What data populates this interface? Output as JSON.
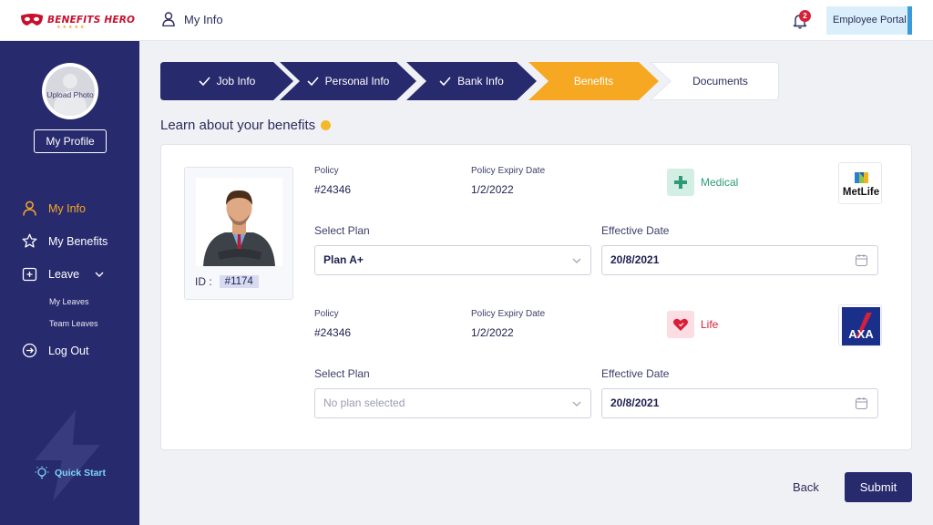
{
  "brand": {
    "name": "BENEFITS HERO"
  },
  "header": {
    "title": "My Info",
    "notifications_count": "2",
    "portal_label": "Employee Portal"
  },
  "sidebar": {
    "avatar_label": "Upload Photo",
    "profile_button": "My Profile",
    "items": [
      {
        "label": "My Info",
        "icon": "user-icon",
        "active": true
      },
      {
        "label": "My Benefits",
        "icon": "star-icon",
        "active": false
      },
      {
        "label": "Leave",
        "icon": "leave-icon",
        "active": false
      },
      {
        "label": "Log Out",
        "icon": "logout-icon",
        "active": false
      }
    ],
    "sub_items": [
      {
        "label": "My Leaves"
      },
      {
        "label": "Team Leaves"
      }
    ],
    "quick_start": "Quick Start"
  },
  "stepper": {
    "steps": [
      {
        "label": "Job Info",
        "state": "done"
      },
      {
        "label": "Personal Info",
        "state": "done"
      },
      {
        "label": "Bank Info",
        "state": "done"
      },
      {
        "label": "Benefits",
        "state": "current"
      },
      {
        "label": "Documents",
        "state": "upcoming"
      }
    ]
  },
  "colors": {
    "navy": "#282a6e",
    "accent": "#f7a823",
    "medical": "#2e9b78",
    "life": "#d6203a"
  },
  "section_title": "Learn about your benefits",
  "employee": {
    "id_label": "ID :",
    "id_value": "#1174"
  },
  "benefits": [
    {
      "policy_label": "Policy",
      "policy": "#24346",
      "expiry_label": "Policy Expiry Date",
      "expiry": "1/2/2022",
      "type": "Medical",
      "provider": "MetLife",
      "select_plan_label": "Select Plan",
      "plan": "Plan A+",
      "effective_label": "Effective Date",
      "effective_date": "20/8/2021"
    },
    {
      "policy_label": "Policy",
      "policy": "#24346",
      "expiry_label": "Policy Expiry Date",
      "expiry": "1/2/2022",
      "type": "Life",
      "provider": "AXA",
      "select_plan_label": "Select Plan",
      "plan_placeholder": "No plan selected",
      "effective_label": "Effective Date",
      "effective_date": "20/8/2021"
    }
  ],
  "actions": {
    "back": "Back",
    "submit": "Submit"
  }
}
